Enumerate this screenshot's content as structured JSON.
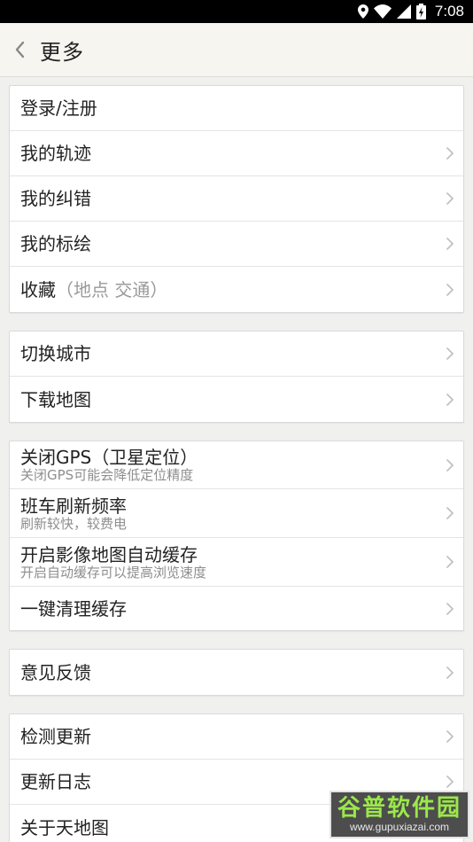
{
  "status_bar": {
    "time": "7:08"
  },
  "header": {
    "title": "更多"
  },
  "groups": [
    {
      "items": [
        {
          "label": "登录/注册"
        },
        {
          "label": "我的轨迹"
        },
        {
          "label": "我的纠错"
        },
        {
          "label": "我的标绘"
        },
        {
          "label": "收藏",
          "hint": "（地点 交通）"
        }
      ]
    },
    {
      "items": [
        {
          "label": "切换城市"
        },
        {
          "label": "下载地图"
        }
      ]
    },
    {
      "items": [
        {
          "label": "关闭GPS（卫星定位）",
          "sub": "关闭GPS可能会降低定位精度"
        },
        {
          "label": "班车刷新频率",
          "sub": "刷新较快，较费电"
        },
        {
          "label": "开启影像地图自动缓存",
          "sub": "开启自动缓存可以提高浏览速度"
        },
        {
          "label": "一键清理缓存"
        }
      ]
    },
    {
      "items": [
        {
          "label": "意见反馈"
        }
      ]
    },
    {
      "items": [
        {
          "label": "检测更新"
        },
        {
          "label": "更新日志"
        },
        {
          "label": "关于天地图"
        }
      ]
    }
  ],
  "watermark": {
    "main": "谷普软件园",
    "url": "www.gupuxiazai.com"
  }
}
